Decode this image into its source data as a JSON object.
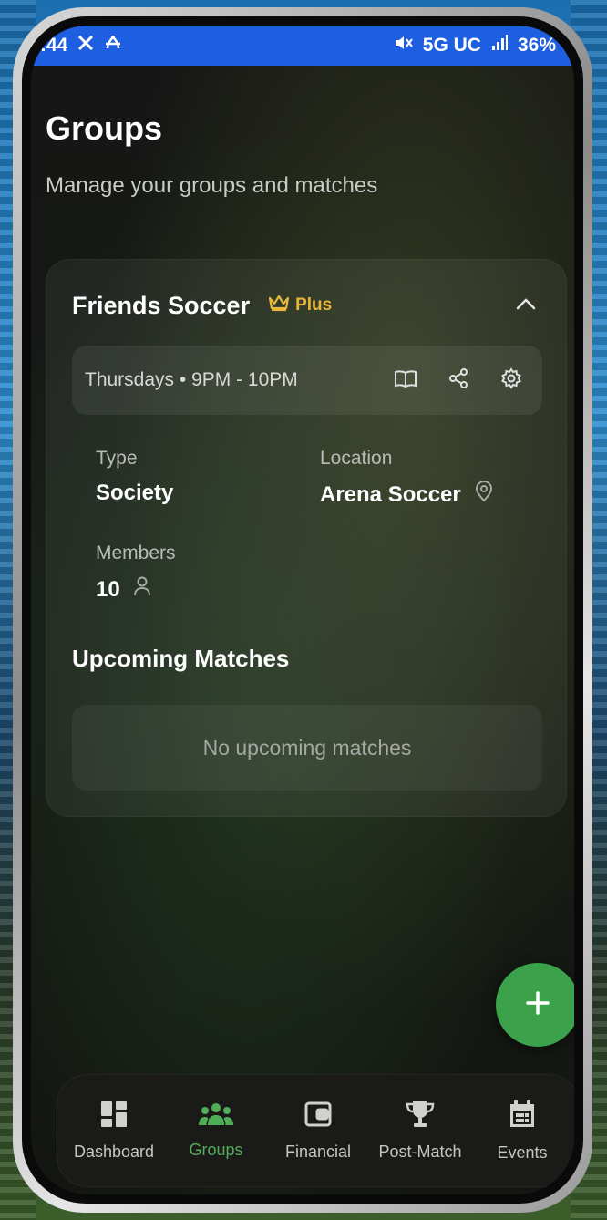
{
  "status_bar": {
    "time": ":44",
    "network": "5G UC",
    "battery": "36%"
  },
  "page": {
    "title": "Groups",
    "subtitle": "Manage your groups and matches"
  },
  "group": {
    "name": "Friends Soccer",
    "plan_badge": "Plus",
    "schedule": "Thursdays • 9PM - 10PM",
    "type_label": "Type",
    "type_value": "Society",
    "location_label": "Location",
    "location_value": "Arena Soccer",
    "members_label": "Members",
    "members_value": "10"
  },
  "upcoming": {
    "title": "Upcoming Matches",
    "empty_text": "No upcoming matches"
  },
  "nav": {
    "items": [
      {
        "label": "Dashboard",
        "icon": "dashboard-icon"
      },
      {
        "label": "Groups",
        "icon": "groups-icon",
        "active": true
      },
      {
        "label": "Financial",
        "icon": "wallet-icon"
      },
      {
        "label": "Post-Match",
        "icon": "trophy-icon"
      },
      {
        "label": "Events",
        "icon": "calendar-icon"
      }
    ]
  },
  "colors": {
    "status_bar": "#1d5fe0",
    "accent_green": "#3ba14a",
    "plus_gold": "#e8b73a"
  }
}
